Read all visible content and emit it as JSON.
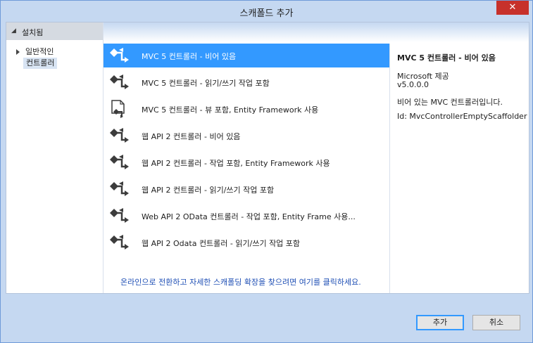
{
  "window": {
    "title": "스캐폴드 추가",
    "close_glyph": "✕"
  },
  "left_panel": {
    "header": "설치됨",
    "tree": [
      {
        "label": "일반적인"
      },
      {
        "label": "컨트롤러"
      }
    ]
  },
  "items": [
    {
      "label": "MVC 5 컨트롤러 - 비어 있음",
      "icon": "mvc-controller-icon"
    },
    {
      "label": "MVC 5 컨트롤러 - 읽기/쓰기 작업 포함",
      "icon": "mvc-controller-icon"
    },
    {
      "label": "MVC 5 컨트롤러 - 뷰 포함, Entity Framework 사용",
      "icon": "mvc-views-icon"
    },
    {
      "label": "웹 API 2 컨트롤러 - 비어 있음",
      "icon": "mvc-controller-icon"
    },
    {
      "label": "웹 API 2 컨트롤러 - 작업 포함, Entity Framework 사용",
      "icon": "mvc-controller-icon"
    },
    {
      "label": "웹 API 2 컨트롤러 - 읽기/쓰기 작업 포함",
      "icon": "mvc-controller-icon"
    },
    {
      "label": "Web API 2 OData 컨트롤러 - 작업 포함, Entity Frame 사용...",
      "icon": "mvc-controller-icon"
    },
    {
      "label": "웹 API 2 Odata 컨트롤러 - 읽기/쓰기 작업 포함",
      "icon": "mvc-controller-icon"
    }
  ],
  "selected_index": 0,
  "online_link": "온라인으로 전환하고 자세한 스캐폴딩 확장을 찾으려면 여기를 클릭하세요.",
  "details": {
    "title": "MVC 5 컨트롤러 - 비어 있음",
    "vendor": "Microsoft 제공",
    "version": "v5.0.0.0",
    "description": "비어 있는 MVC 컨트롤러입니다.",
    "id": "Id: MvcControllerEmptyScaffolder"
  },
  "buttons": {
    "add": "추가",
    "cancel": "취소"
  },
  "colors": {
    "selection": "#3399ff",
    "link": "#1f4fb5",
    "close": "#c7312b"
  }
}
